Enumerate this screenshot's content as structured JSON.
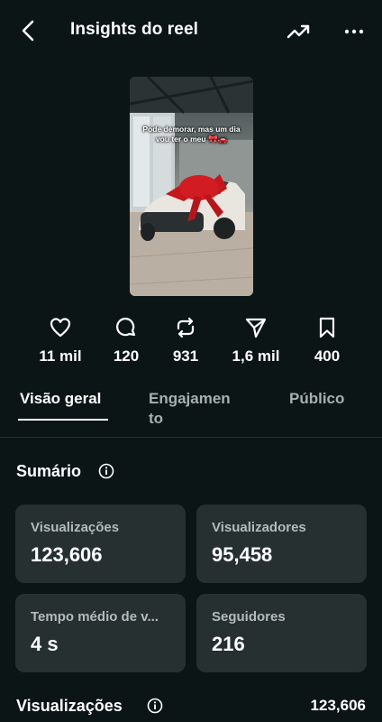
{
  "header": {
    "title": "Insights do reel",
    "back_icon": "chevron-left-icon",
    "trend_icon": "trending-up-icon",
    "more_icon": "more-horizontal-icon"
  },
  "reel": {
    "caption": "Pode demorar, mas um dia vou ter o meu 🎀🚗"
  },
  "stats": [
    {
      "icon": "heart-icon",
      "value": "11 mil"
    },
    {
      "icon": "comment-icon",
      "value": "120"
    },
    {
      "icon": "repost-icon",
      "value": "931"
    },
    {
      "icon": "send-icon",
      "value": "1,6 mil"
    },
    {
      "icon": "bookmark-icon",
      "value": "400"
    }
  ],
  "tabs": [
    {
      "label": "Visão geral",
      "active": true
    },
    {
      "label": "Engajamen\nto",
      "active": false
    },
    {
      "label": "Público",
      "active": false
    }
  ],
  "summary": {
    "title": "Sumário",
    "cards": [
      {
        "label": "Visualizações",
        "value": "123,606"
      },
      {
        "label": "Visualizadores",
        "value": "95,458"
      },
      {
        "label": "Tempo médio de v...",
        "value": "4 s"
      },
      {
        "label": "Seguidores",
        "value": "216"
      }
    ]
  },
  "views": {
    "title": "Visualizações",
    "total": "123,606"
  },
  "colors": {
    "background": "#0b1516",
    "card": "#273031",
    "muted_text": "#b3bbbb"
  }
}
